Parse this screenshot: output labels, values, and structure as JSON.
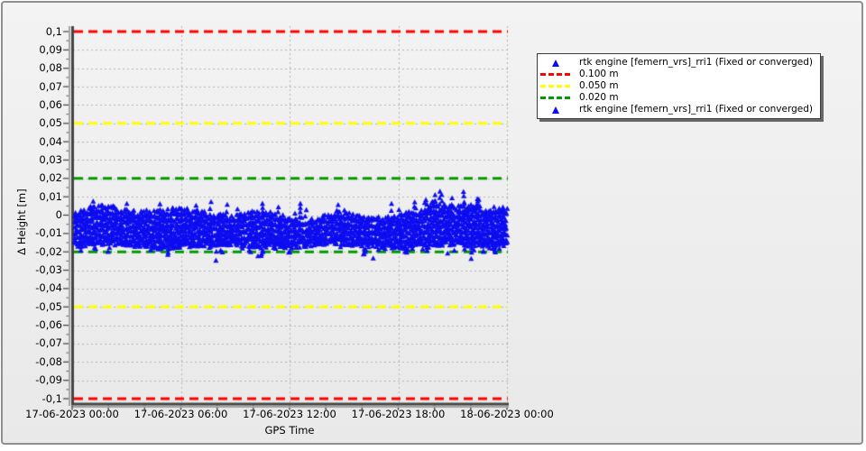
{
  "chart_data": {
    "type": "scatter",
    "title": "",
    "xlabel": "GPS Time",
    "ylabel": "Δ Height [m]",
    "ylim": [
      -0.1,
      0.1
    ],
    "y_tick_step": 0.01,
    "y_tick_labels": [
      "0,1",
      "0,09",
      "0,08",
      "0,07",
      "0,06",
      "0,05",
      "0,04",
      "0,03",
      "0,02",
      "0,01",
      "0",
      "-0,01",
      "-0,02",
      "-0,03",
      "-0,04",
      "-0,05",
      "-0,06",
      "-0,07",
      "-0,08",
      "-0,09",
      "-0,1"
    ],
    "x_tick_labels": [
      "17-06-2023 00:00",
      "17-06-2023 06:00",
      "17-06-2023 12:00",
      "17-06-2023 18:00",
      "18-06-2023 00:00"
    ],
    "x_span_hours": 24,
    "x_major_tick_hours": 6,
    "x_minor_tick_hours": 2,
    "grid": "dashed",
    "threshold_lines": [
      {
        "label": "0.100 m",
        "values": [
          0.1,
          -0.1
        ],
        "color": "#ff0000",
        "style": "dashed"
      },
      {
        "label": "0.050 m",
        "values": [
          0.05,
          -0.05
        ],
        "color": "#ffff00",
        "style": "dashed"
      },
      {
        "label": "0.020 m",
        "values": [
          0.02,
          -0.02
        ],
        "color": "#009b00",
        "style": "dashed"
      }
    ],
    "series": [
      {
        "name": "rtk engine [femern_vrs]_rri1 (Fixed or converged)",
        "marker": "triangle",
        "color": "#0d0df0",
        "description": "dense noise band of height residuals",
        "band": {
          "x_start_hours": 0.15,
          "x_end_hours": 24,
          "top_typical_m": 0.002,
          "bottom_typical_m": -0.016,
          "spike_top_max_m": 0.012,
          "elevated_region_hours": [
            19.5,
            22.5
          ],
          "outlier_min_m": -0.026,
          "outlier_fraction": 0.02
        },
        "seed": 1337
      }
    ]
  },
  "legend": {
    "items": [
      {
        "swatch": "triangle",
        "color": "#0d0df0",
        "label": "rtk engine [femern_vrs]_rri1 (Fixed or converged)"
      },
      {
        "swatch": "dashes",
        "color": "#ff0000",
        "label": "0.100 m"
      },
      {
        "swatch": "dashes",
        "color": "#ffff00",
        "label": "0.050 m"
      },
      {
        "swatch": "dashes",
        "color": "#009b00",
        "label": "0.020 m"
      },
      {
        "swatch": "triangle",
        "color": "#0d0df0",
        "label": "rtk engine [femern_vrs]_rri1 (Fixed or converged)"
      }
    ]
  },
  "colors": {
    "panel_border": "#8f8f8f",
    "panel_bg": "#ececec",
    "gridline": "#b5b5b5",
    "axis": "#454545",
    "axis_shadow": "#a5a5a5",
    "marker_blue": "#0d0df0"
  }
}
